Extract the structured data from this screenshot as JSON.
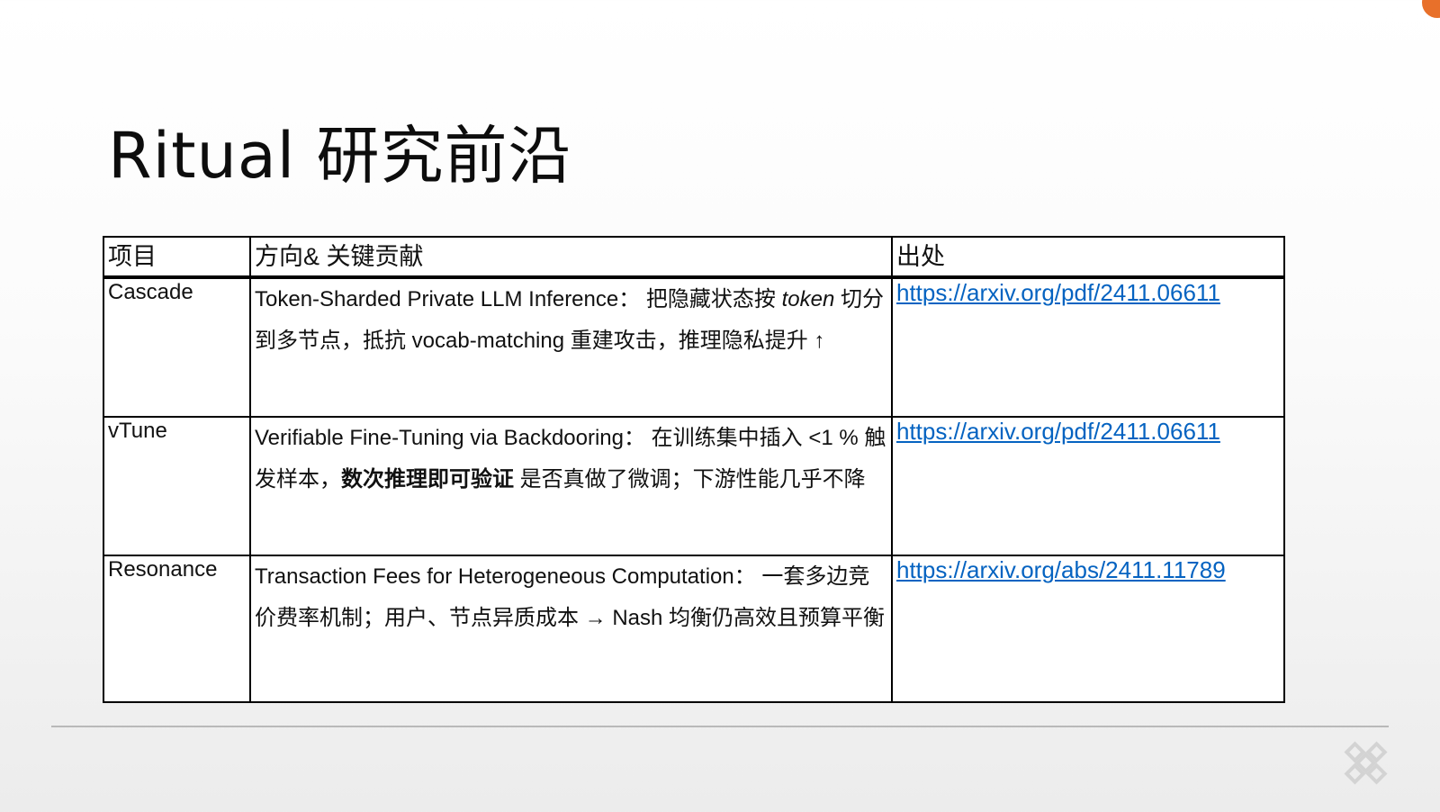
{
  "slide": {
    "title": "Ritual 研究前沿",
    "colors": {
      "accent_badge": "#e8702a",
      "link": "#0563c1",
      "rule": "#b9b9b9",
      "logo": "#d3d3d3"
    }
  },
  "table": {
    "headers": [
      "项目",
      "方向& 关键贡献",
      "出处"
    ],
    "rows": [
      {
        "name": "Cascade",
        "desc_title": "Token-Sharded Private LLM Inference：",
        "desc_a": " 把隐藏状态按 ",
        "desc_em": "token",
        "desc_b": " 切分到多节点，抵抗 vocab-matching 重建攻击，推理隐私提升 ",
        "desc_c": "↑",
        "source": "https://arxiv.org/pdf/2411.06611"
      },
      {
        "name": "vTune",
        "desc_title": "Verifiable Fine-Tuning via Backdooring：",
        "desc_a": " 在训练集中插入 <1 % 触发样本，",
        "desc_strong": "数次推理即可验证",
        "desc_b": " 是否真做了微调；下游性能几乎不降",
        "source": "https://arxiv.org/pdf/2411.06611"
      },
      {
        "name": "Resonance",
        "desc_title": "Transaction Fees for Heterogeneous Computation：",
        "desc_a": " 一套多边竞价费率机制；用户、节点异质成本 → Nash 均衡仍高效且预算平衡",
        "source": "https://arxiv.org/abs/2411.11789"
      }
    ]
  },
  "footer": {
    "logo_icon": "endless-knot-logo-icon"
  }
}
